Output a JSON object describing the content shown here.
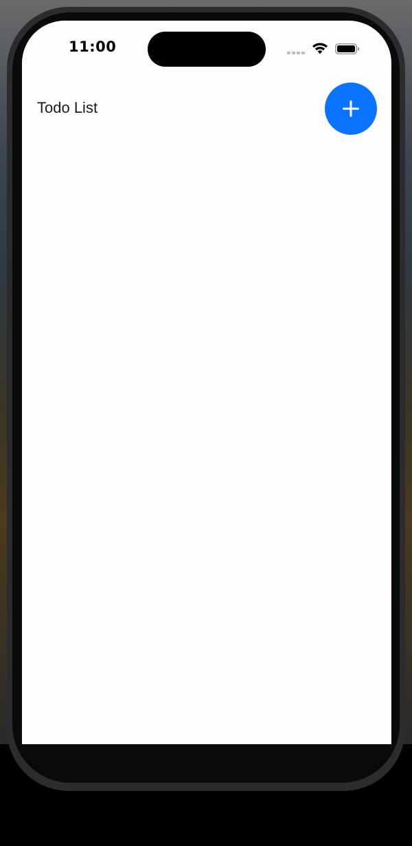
{
  "status_bar": {
    "time": "11:00",
    "icons": [
      "cellular-signal-icon",
      "wifi-icon",
      "battery-icon"
    ]
  },
  "header": {
    "title": "Todo List",
    "add_button": {
      "icon": "plus-icon",
      "color": "#0a74ff"
    }
  },
  "todo_list": {
    "items": []
  },
  "colors": {
    "accent": "#0a74ff",
    "screen_background": "#fdfcff",
    "text": "#1c1c1e"
  }
}
